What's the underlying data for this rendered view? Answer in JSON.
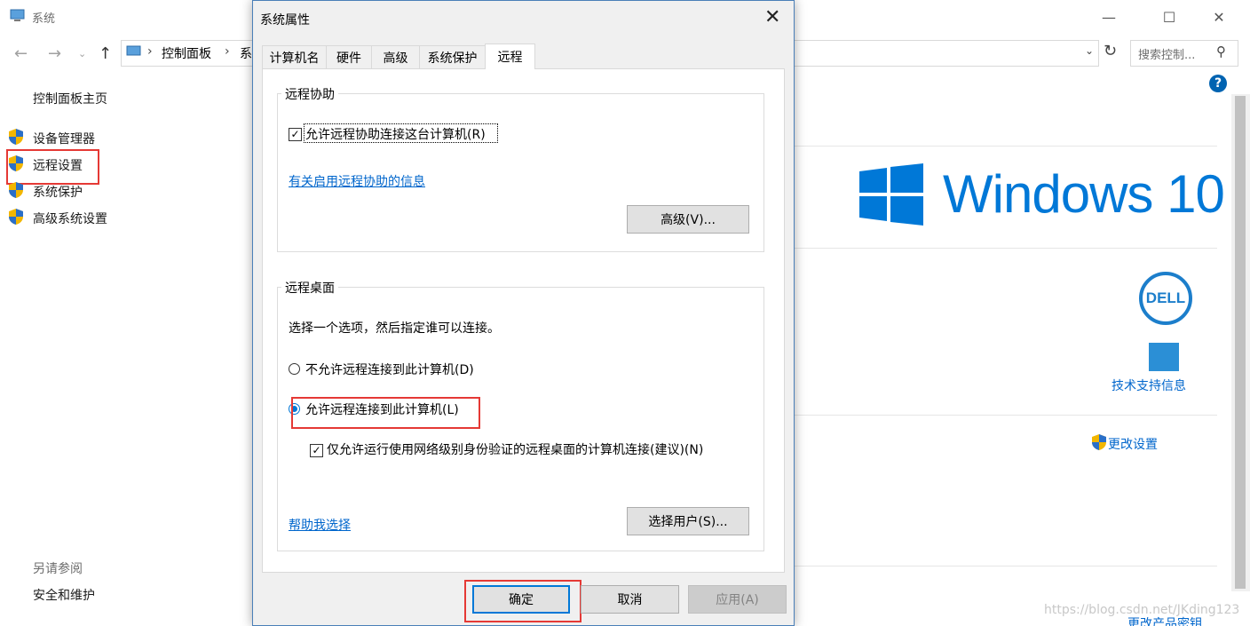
{
  "bg_window": {
    "title": "系统",
    "address_segments": [
      "控制面板",
      "系"
    ],
    "search_placeholder": "搜索控制...",
    "help_glyph": "?",
    "sidebar": {
      "home": "控制面板主页",
      "items": [
        {
          "label": "设备管理器",
          "icon": "shield-icon"
        },
        {
          "label": "远程设置",
          "icon": "shield-icon"
        },
        {
          "label": "系统保护",
          "icon": "shield-icon"
        },
        {
          "label": "高级系统设置",
          "icon": "shield-icon"
        }
      ],
      "see_also": "另请参阅",
      "security": "安全和维护"
    },
    "brand_text": "Windows 10",
    "oem_logo_text": "DELL",
    "support_link": "技术支持信息",
    "change_settings": "更改设置",
    "bottom_link": "更改产品密钥",
    "watermark": "https://blog.csdn.net/JKding123"
  },
  "dialog": {
    "title": "系统属性",
    "tabs": [
      "计算机名",
      "硬件",
      "高级",
      "系统保护",
      "远程"
    ],
    "active_tab": "远程",
    "remote_assist": {
      "label": "远程协助",
      "checkbox": "允许远程协助连接这台计算机(R)",
      "checked": true,
      "info_link": "有关启用远程协助的信息",
      "advanced_button": "高级(V)..."
    },
    "remote_desktop": {
      "label": "远程桌面",
      "instruction": "选择一个选项，然后指定谁可以连接。",
      "option_deny": "不允许远程连接到此计算机(D)",
      "option_allow": "允许远程连接到此计算机(L)",
      "selected": "allow",
      "nla_checkbox": "仅允许运行使用网络级别身份验证的远程桌面的计算机连接(建议)(N)",
      "nla_checked": true,
      "help_link": "帮助我选择",
      "select_users_button": "选择用户(S)..."
    },
    "buttons": {
      "ok": "确定",
      "cancel": "取消",
      "apply": "应用(A)"
    }
  },
  "colors": {
    "accent": "#0078d7",
    "highlight_box": "#e53935",
    "link": "#0066cc"
  }
}
